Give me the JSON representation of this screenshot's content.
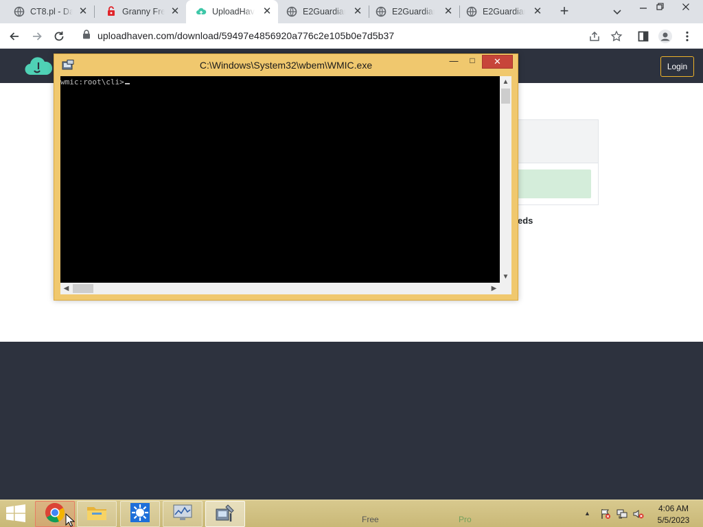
{
  "browser": {
    "tabs": [
      {
        "title": "CT8.pl - Dar",
        "icon": "globe-icon",
        "active": false
      },
      {
        "title": "Granny Free",
        "icon": "granny-game-icon",
        "active": false
      },
      {
        "title": "UploadHave",
        "icon": "uploadhaven-icon",
        "active": true
      },
      {
        "title": "E2Guardian -",
        "icon": "globe-icon",
        "active": false
      },
      {
        "title": "E2Guardian",
        "icon": "globe-icon",
        "active": false
      },
      {
        "title": "E2Guardian",
        "icon": "globe-icon",
        "active": false
      }
    ],
    "tab_close_glyph": "✕",
    "new_tab_glyph": "+",
    "url": "uploadhaven.com/download/59497e4856920a776c2e105b0e7d5b37"
  },
  "site": {
    "login_label": "Login",
    "partial_text": "eds",
    "colors": {
      "header": "#2d323e",
      "login_border": "#f0b429",
      "success_bar": "#d4edda"
    }
  },
  "console": {
    "title": "C:\\Windows\\System32\\wbem\\WMIC.exe",
    "prompt": "wmic:root\\cli>",
    "min_glyph": "—",
    "max_glyph": "□",
    "close_glyph": "✕"
  },
  "taskbar": {
    "apps": [
      {
        "name": "Google Chrome",
        "icon": "chrome-icon"
      },
      {
        "name": "File Explorer",
        "icon": "folder-icon"
      },
      {
        "name": "Settings",
        "icon": "sun-gear-icon"
      },
      {
        "name": "Performance Monitor",
        "icon": "monitor-chart-icon"
      },
      {
        "name": "System Tools",
        "icon": "tools-icon"
      }
    ],
    "free_label": "Free",
    "pro_label": "Pro",
    "time": "4:06 AM",
    "date": "5/5/2023"
  }
}
